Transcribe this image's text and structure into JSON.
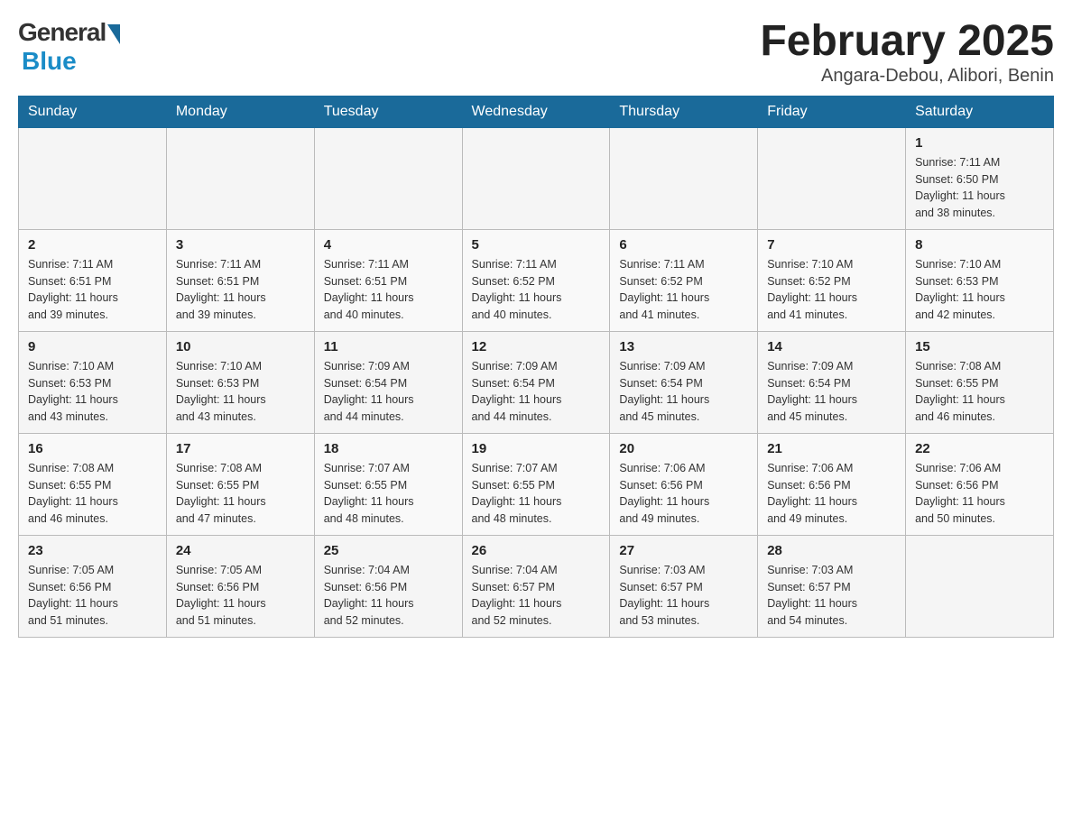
{
  "logo": {
    "general": "General",
    "blue": "Blue"
  },
  "title": "February 2025",
  "subtitle": "Angara-Debou, Alibori, Benin",
  "weekdays": [
    "Sunday",
    "Monday",
    "Tuesday",
    "Wednesday",
    "Thursday",
    "Friday",
    "Saturday"
  ],
  "weeks": [
    {
      "days": [
        {
          "num": "",
          "info": ""
        },
        {
          "num": "",
          "info": ""
        },
        {
          "num": "",
          "info": ""
        },
        {
          "num": "",
          "info": ""
        },
        {
          "num": "",
          "info": ""
        },
        {
          "num": "",
          "info": ""
        },
        {
          "num": "1",
          "info": "Sunrise: 7:11 AM\nSunset: 6:50 PM\nDaylight: 11 hours\nand 38 minutes."
        }
      ]
    },
    {
      "days": [
        {
          "num": "2",
          "info": "Sunrise: 7:11 AM\nSunset: 6:51 PM\nDaylight: 11 hours\nand 39 minutes."
        },
        {
          "num": "3",
          "info": "Sunrise: 7:11 AM\nSunset: 6:51 PM\nDaylight: 11 hours\nand 39 minutes."
        },
        {
          "num": "4",
          "info": "Sunrise: 7:11 AM\nSunset: 6:51 PM\nDaylight: 11 hours\nand 40 minutes."
        },
        {
          "num": "5",
          "info": "Sunrise: 7:11 AM\nSunset: 6:52 PM\nDaylight: 11 hours\nand 40 minutes."
        },
        {
          "num": "6",
          "info": "Sunrise: 7:11 AM\nSunset: 6:52 PM\nDaylight: 11 hours\nand 41 minutes."
        },
        {
          "num": "7",
          "info": "Sunrise: 7:10 AM\nSunset: 6:52 PM\nDaylight: 11 hours\nand 41 minutes."
        },
        {
          "num": "8",
          "info": "Sunrise: 7:10 AM\nSunset: 6:53 PM\nDaylight: 11 hours\nand 42 minutes."
        }
      ]
    },
    {
      "days": [
        {
          "num": "9",
          "info": "Sunrise: 7:10 AM\nSunset: 6:53 PM\nDaylight: 11 hours\nand 43 minutes."
        },
        {
          "num": "10",
          "info": "Sunrise: 7:10 AM\nSunset: 6:53 PM\nDaylight: 11 hours\nand 43 minutes."
        },
        {
          "num": "11",
          "info": "Sunrise: 7:09 AM\nSunset: 6:54 PM\nDaylight: 11 hours\nand 44 minutes."
        },
        {
          "num": "12",
          "info": "Sunrise: 7:09 AM\nSunset: 6:54 PM\nDaylight: 11 hours\nand 44 minutes."
        },
        {
          "num": "13",
          "info": "Sunrise: 7:09 AM\nSunset: 6:54 PM\nDaylight: 11 hours\nand 45 minutes."
        },
        {
          "num": "14",
          "info": "Sunrise: 7:09 AM\nSunset: 6:54 PM\nDaylight: 11 hours\nand 45 minutes."
        },
        {
          "num": "15",
          "info": "Sunrise: 7:08 AM\nSunset: 6:55 PM\nDaylight: 11 hours\nand 46 minutes."
        }
      ]
    },
    {
      "days": [
        {
          "num": "16",
          "info": "Sunrise: 7:08 AM\nSunset: 6:55 PM\nDaylight: 11 hours\nand 46 minutes."
        },
        {
          "num": "17",
          "info": "Sunrise: 7:08 AM\nSunset: 6:55 PM\nDaylight: 11 hours\nand 47 minutes."
        },
        {
          "num": "18",
          "info": "Sunrise: 7:07 AM\nSunset: 6:55 PM\nDaylight: 11 hours\nand 48 minutes."
        },
        {
          "num": "19",
          "info": "Sunrise: 7:07 AM\nSunset: 6:55 PM\nDaylight: 11 hours\nand 48 minutes."
        },
        {
          "num": "20",
          "info": "Sunrise: 7:06 AM\nSunset: 6:56 PM\nDaylight: 11 hours\nand 49 minutes."
        },
        {
          "num": "21",
          "info": "Sunrise: 7:06 AM\nSunset: 6:56 PM\nDaylight: 11 hours\nand 49 minutes."
        },
        {
          "num": "22",
          "info": "Sunrise: 7:06 AM\nSunset: 6:56 PM\nDaylight: 11 hours\nand 50 minutes."
        }
      ]
    },
    {
      "days": [
        {
          "num": "23",
          "info": "Sunrise: 7:05 AM\nSunset: 6:56 PM\nDaylight: 11 hours\nand 51 minutes."
        },
        {
          "num": "24",
          "info": "Sunrise: 7:05 AM\nSunset: 6:56 PM\nDaylight: 11 hours\nand 51 minutes."
        },
        {
          "num": "25",
          "info": "Sunrise: 7:04 AM\nSunset: 6:56 PM\nDaylight: 11 hours\nand 52 minutes."
        },
        {
          "num": "26",
          "info": "Sunrise: 7:04 AM\nSunset: 6:57 PM\nDaylight: 11 hours\nand 52 minutes."
        },
        {
          "num": "27",
          "info": "Sunrise: 7:03 AM\nSunset: 6:57 PM\nDaylight: 11 hours\nand 53 minutes."
        },
        {
          "num": "28",
          "info": "Sunrise: 7:03 AM\nSunset: 6:57 PM\nDaylight: 11 hours\nand 54 minutes."
        },
        {
          "num": "",
          "info": ""
        }
      ]
    }
  ]
}
